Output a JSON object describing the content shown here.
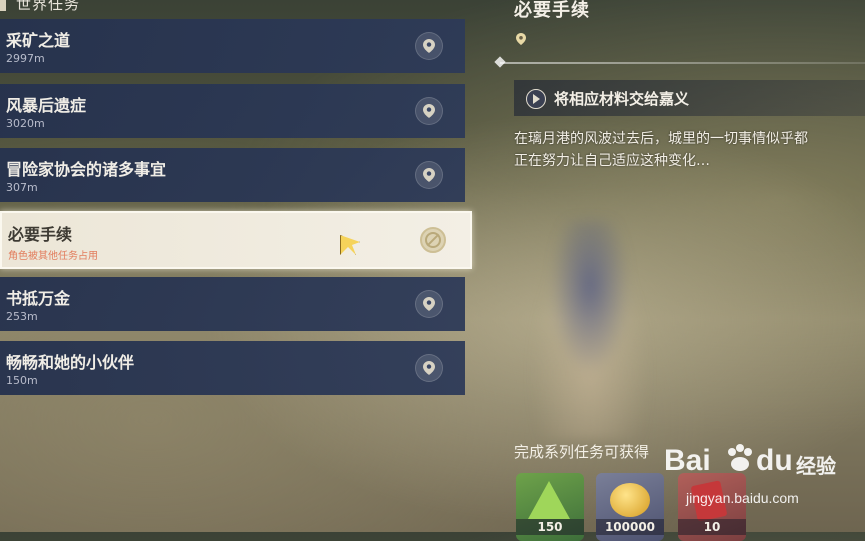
{
  "header": {
    "title": "世界任务"
  },
  "quests": [
    {
      "name": "采矿之道",
      "distance": "2997m"
    },
    {
      "name": "风暴后遗症",
      "distance": "3020m"
    },
    {
      "name": "冒险家协会的诸多事宜",
      "distance": "307m"
    },
    {
      "name": "必要手续",
      "status": "角色被其他任务占用"
    },
    {
      "name": "书抵万金",
      "distance": "253m"
    },
    {
      "name": "畅畅和她的小伙伴",
      "distance": "150m"
    }
  ],
  "detail": {
    "title": "必要手续",
    "step": "将相应材料交给嘉义",
    "description_line1": "在璃月港的风波过去后，城里的一切事情似乎都",
    "description_line2": "正在努力让自己适应这种变化…",
    "rewards_title": "完成系列任务可获得",
    "rewards": [
      {
        "icon": "adventure-exp-icon",
        "count": "150"
      },
      {
        "icon": "mora-coin-icon",
        "count": "100000"
      },
      {
        "icon": "red-item-icon",
        "count": "10"
      }
    ]
  },
  "watermark": {
    "brand_left": "Bai",
    "brand_right": "du",
    "brand_cn": "经验",
    "url": "jingyan.baidu.com"
  },
  "colors": {
    "quest_bg": "#2d3a58",
    "active_bg": "#f3efe5",
    "blocked_text": "#e27c5c",
    "text_light": "#f3efe6"
  }
}
